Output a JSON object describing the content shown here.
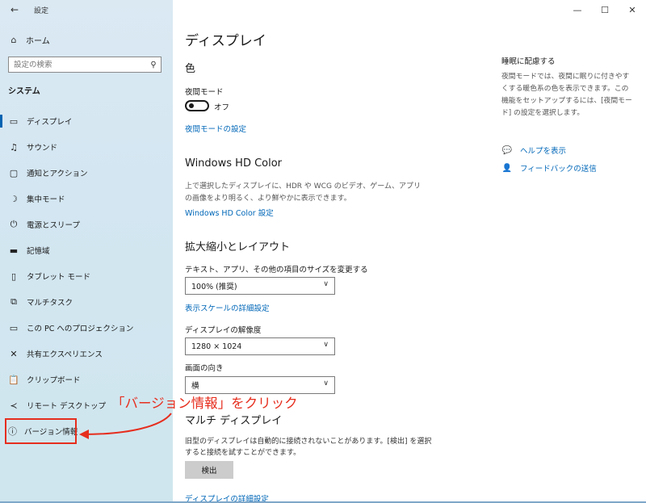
{
  "window": {
    "title": "設定",
    "controls": {
      "minimize": "—",
      "maximize": "☐",
      "close": "✕"
    }
  },
  "sidebar": {
    "back_icon": "←",
    "home": {
      "icon": "⌂",
      "label": "ホーム"
    },
    "search": {
      "placeholder": "設定の検索",
      "icon": "⚲"
    },
    "section_title": "システム",
    "items": [
      {
        "icon": "▭",
        "label": "ディスプレイ",
        "active": true
      },
      {
        "icon": "♫",
        "label": "サウンド"
      },
      {
        "icon": "▢",
        "label": "通知とアクション"
      },
      {
        "icon": "☽",
        "label": "集中モード"
      },
      {
        "icon": "⏻",
        "label": "電源とスリープ"
      },
      {
        "icon": "▬",
        "label": "記憶域"
      },
      {
        "icon": "▯",
        "label": "タブレット モード"
      },
      {
        "icon": "⧉",
        "label": "マルチタスク"
      },
      {
        "icon": "▭",
        "label": "この PC へのプロジェクション"
      },
      {
        "icon": "✕",
        "label": "共有エクスペリエンス"
      },
      {
        "icon": "📋",
        "label": "クリップボード"
      },
      {
        "icon": "≺",
        "label": "リモート デスクトップ"
      },
      {
        "icon": "ⓘ",
        "label": "バージョン情報",
        "highlight": true
      }
    ]
  },
  "main": {
    "title": "ディスプレイ",
    "color_heading": "色",
    "night_mode_label": "夜間モード",
    "night_mode_state": "オフ",
    "night_mode_link": "夜間モードの設定",
    "hdr_heading": "Windows HD Color",
    "hdr_desc": "上で選択したディスプレイに、HDR や WCG のビデオ、ゲーム、アプリの画像をより明るく、より鮮やかに表示できます。",
    "hdr_link": "Windows HD Color 設定",
    "scale_heading": "拡大縮小とレイアウト",
    "scale_label": "テキスト、アプリ、その他の項目のサイズを変更する",
    "scale_value": "100% (推奨)",
    "scale_link": "表示スケールの詳細設定",
    "resolution_label": "ディスプレイの解像度",
    "resolution_value": "1280 × 1024",
    "orientation_label": "画面の向き",
    "orientation_value": "横",
    "multi_heading": "マルチ ディスプレイ",
    "multi_desc": "旧型のディスプレイは自動的に接続されないことがあります。[検出] を選択すると接続を試すことができます。",
    "detect_button": "検出",
    "advanced_link": "ディスプレイの詳細設定",
    "chevron": "∨"
  },
  "side_panel": {
    "title": "睡眠に配慮する",
    "desc": "夜間モードでは、夜間に眠りに付きやすくする暖色系の色を表示できます。この機能をセットアップするには、[夜間モード] の設定を選択します。",
    "help_links": [
      {
        "icon": "💬",
        "label": "ヘルプを表示"
      },
      {
        "icon": "👤",
        "label": "フィードバックの送信"
      }
    ]
  },
  "annotation": {
    "text": "「バージョン情報」をクリック",
    "color": "#e62e1e"
  },
  "colors": {
    "accent": "#0067b8",
    "sidebar_bg": "#d6e7f2",
    "highlight": "#e62e1e"
  }
}
